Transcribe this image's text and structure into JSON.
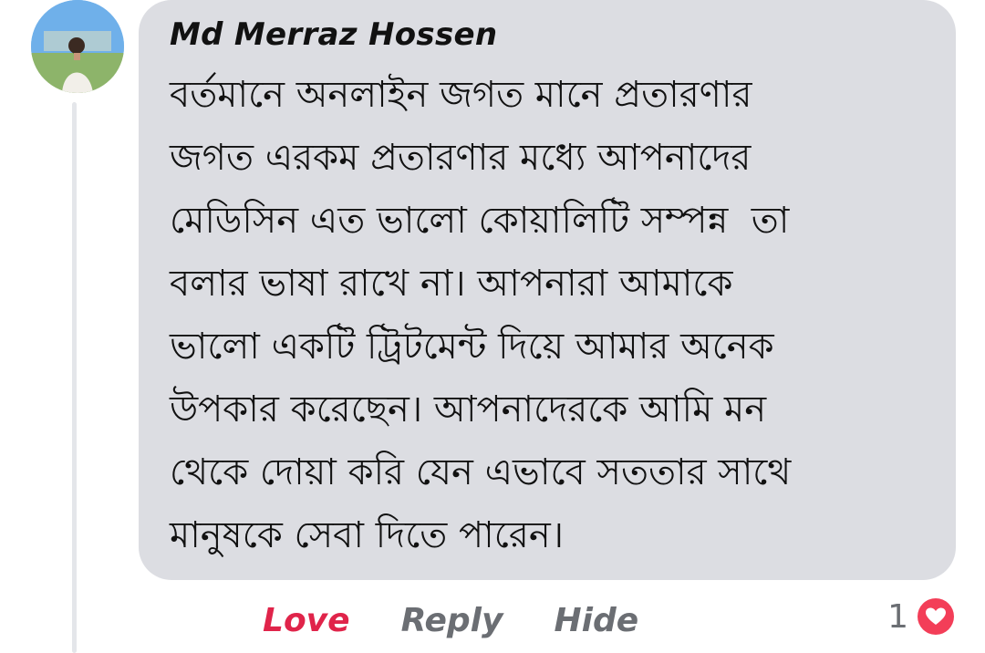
{
  "comment": {
    "author": "Md Merraz Hossen",
    "text": "বর্তমানে অনলাইন জগত মানে প্রতারণার\nজগত এরকম প্রতারণার মধ্যে আপনাদের\nমেডিসিন এত ভালো কোয়ালিটি সম্পন্ন  তা\nবলার ভাষা রাখে না। আপনারা আমাকে\nভালো একটি ট্রিটমেন্ট দিয়ে আমার অনেক\nউপকার করেছেন। আপনাদেরকে আমি মন\nথেকে দোয়া করি যেন এভাবে সততার সাথে\nমানুষকে সেবা দিতে পারেন।"
  },
  "actions": {
    "love_label": "Love",
    "reply_label": "Reply",
    "hide_label": "Hide"
  },
  "reactions": {
    "count": "1",
    "icon": "heart-icon",
    "color": "#f33e58"
  },
  "colors": {
    "bubble_bg": "#dcdde2",
    "love_active": "#e0244a",
    "action_text": "#6b6e73"
  }
}
